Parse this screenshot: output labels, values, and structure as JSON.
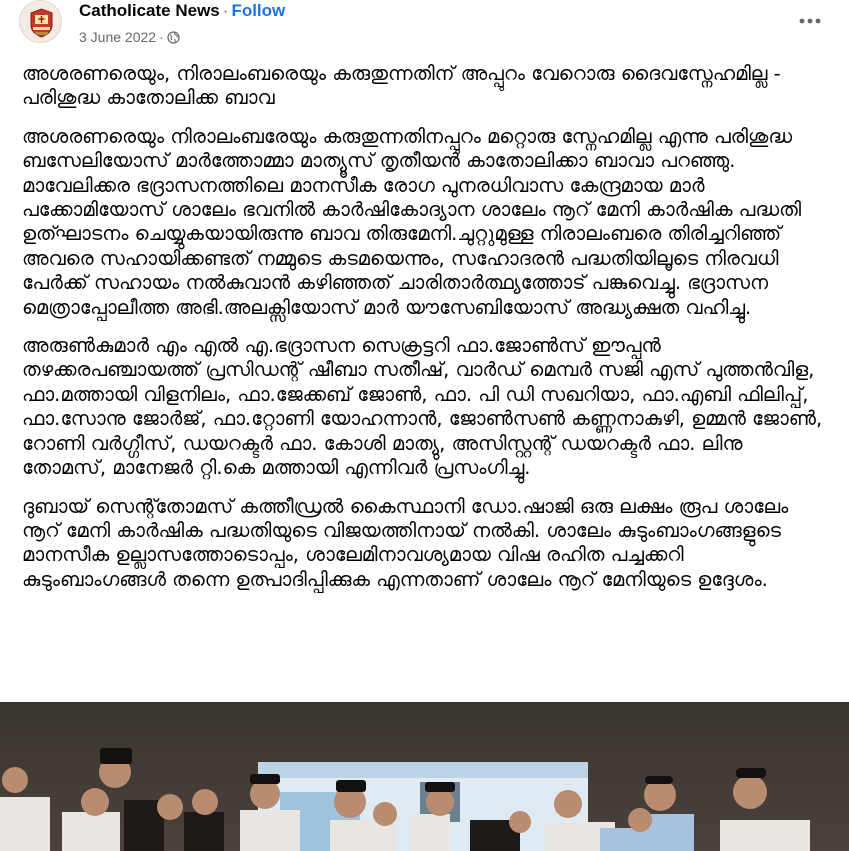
{
  "post": {
    "page_name": "Catholicate News",
    "separator": "·",
    "follow_label": "Follow",
    "date": "3 June 2022",
    "meta_separator": "·",
    "audience_icon": "globe-icon",
    "more_icon": "more-options-icon",
    "avatar_icon": "catholicate-news-logo"
  },
  "content": {
    "paragraphs": [
      "അശരണരെയും, നിരാലംബരെയും കരുതുന്നതിന് അപ്പുറം വേറൊരു ദൈവസ്നേഹമില്ല  - പരിശുദ്ധ കാതോലിക്ക ബാവ",
      "അശരണരെയും നിരാലംബരേയും കരുതുന്നതിനപ്പുറം മറ്റൊരു സ്നേഹമില്ല എന്നു പരിശുദ്ധ ബസേലിയോസ് മാർത്തോമ്മാ മാത്യൂസ് തൃതീയൻ കാതോലിക്കാ ബാവാ പറഞ്ഞു. മാവേലിക്കര ഭദ്രാസനത്തിലെ മാനസീക രോഗ പുനരധിവാസ കേന്ദ്രമായ മാർ പക്കോമിയോസ് ശാലേം ഭവനിൽ കാർഷികോദ്യാന ശാലേം നൂറ് മേനി കാർഷിക പദ്ധതി ഉത്ഘാടനം ചെയ്യുകയായിരുന്നു ബാവ തിരുമേനി.ചുറ്റുമുള്ള നിരാലംബരെ തിരിച്ചറിഞ്ഞ് അവരെ സഹായിക്കണ്ടത് നമ്മുടെ കടമയെന്നും, സഹോദരൻ പദ്ധതിയിലൂടെ നിരവധി പേർക്ക് സഹായം നൽകുവാൻ കഴിഞ്ഞത് ചാരിതാർത്ഥ്യത്തോട് പങ്കുവെച്ചു. ഭദ്രാസന മെത്രാപ്പോലീത്ത അഭി.അലക്സിയോസ് മാർ യൗസേബിയോസ് അദ്ധ്യക്ഷത വഹിച്ചു.",
      "അരുൺകുമാർ എം എൽ എ.ഭദ്രാസന സെക്രട്ടറി ഫാ.ജോൺസ് ഈപ്പൻ തഴക്കരപഞ്ചായത്ത് പ്രസിഡന്റ് ഷീബാ സതീഷ്, വാർഡ് മെമ്പർ സജി എസ് പുത്തൻവിള,  ഫാ.മത്തായി വിളനിലം, ഫാ.ജേക്കബ് ജോൺ, ഫാ. പി ഡി സഖറിയാ, ഫാ.എബി ഫിലിപ്പ്, ഫാ.സോനു ജോർജ്, ഫാ.റ്റോണി യോഹന്നാൻ, ജോൺസൺ കണ്ണനാകുഴി, ഉമ്മൻ ജോൺ, റോണി വർഗ്ഗീസ്, ഡയറക്ടർ ഫാ. കോശി മാത്യു, അസിസ്റ്റന്റ് ഡയറക്ടർ ഫാ. ലിനു തോമസ്, മാനേജർ റ്റി.കെ മത്തായി എന്നിവർ പ്രസംഗിച്ചു.",
      "ദുബായ് സെന്റ്തോമസ് കത്തീഡ്രൽ കൈസ്ഥാനി ഡോ.ഷാജി ഒരു ലക്ഷം രൂപ ശാലേം നൂറ് മേനി കാർഷിക പദ്ധതിയുടെ വിജയത്തിനായ്  നൽകി. ശാലേം കുടുംബാംഗങ്ങളുടെ മാനസീക ഉല്ലാസത്തോടൊപ്പം, ശാലേമിനാവശ്യമായ വിഷ രഹിത പച്ചക്കറി കുടുംബാംഗങ്ങൾ തന്നെ ഉത്പാദിപ്പിക്കുക എന്നതാണ് ശാലേം നൂറ് മേനിയുടെ ഉദ്ദേശം."
    ]
  },
  "photo": {
    "description_icon": "event-photo"
  },
  "colors": {
    "link": "#1b74e4",
    "secondary_text": "#65676b",
    "primary_text": "#050505"
  }
}
